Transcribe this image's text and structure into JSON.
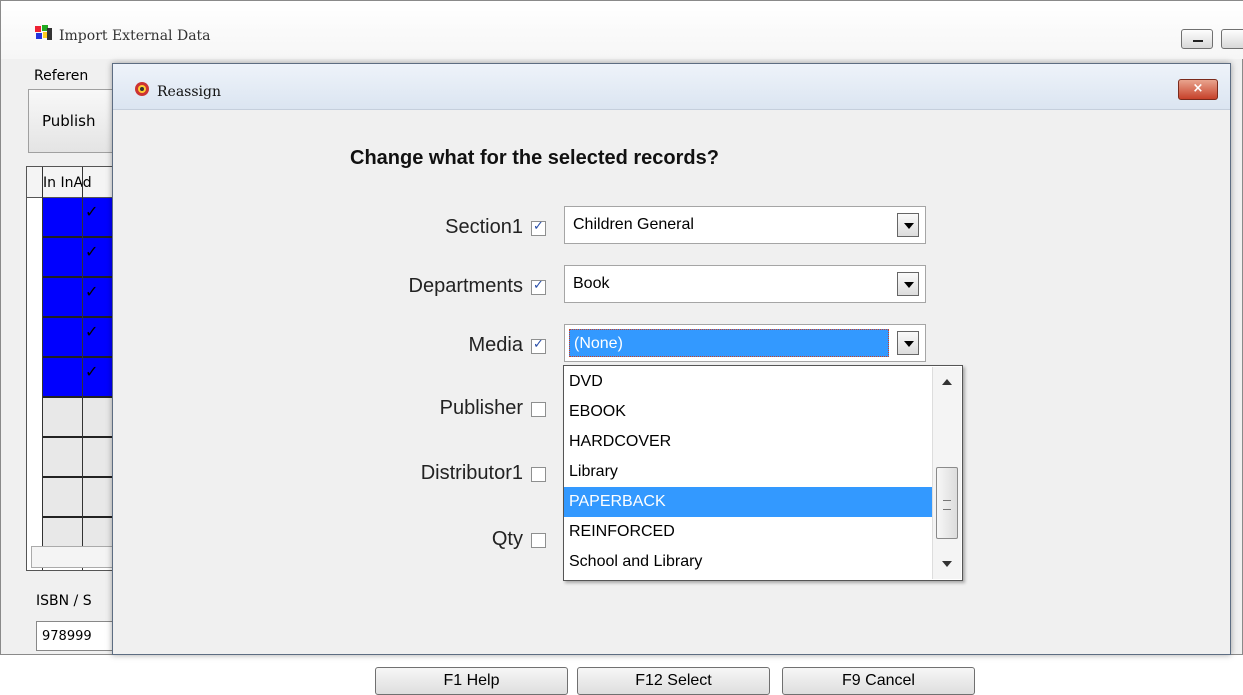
{
  "outer_window": {
    "title": "Import External Data",
    "reference_label": "Referen",
    "publisher_button": "Publish",
    "grid_header": "In InAd",
    "isbn_label": "ISBN / S",
    "isbn_value": "978999"
  },
  "dialog": {
    "title": "Reassign",
    "close_label": "×",
    "question": "Change what for the selected records?",
    "fields": [
      {
        "label": "Section1",
        "checked": true,
        "value": "Children General"
      },
      {
        "label": "Departments",
        "checked": true,
        "value": "Book"
      },
      {
        "label": "Media",
        "checked": true,
        "value": "(None)"
      },
      {
        "label": "Publisher",
        "checked": false,
        "value": ""
      },
      {
        "label": "Distributor1",
        "checked": false,
        "value": ""
      },
      {
        "label": "Qty",
        "checked": false,
        "value": ""
      }
    ],
    "media_options": [
      "DVD",
      "EBOOK",
      "HARDCOVER",
      "Library",
      "PAPERBACK",
      "REINFORCED",
      "School and Library"
    ],
    "highlighted_option": "PAPERBACK",
    "buttons": {
      "help": "F1 Help",
      "select": "F12 Select",
      "cancel": "F9 Cancel"
    }
  }
}
